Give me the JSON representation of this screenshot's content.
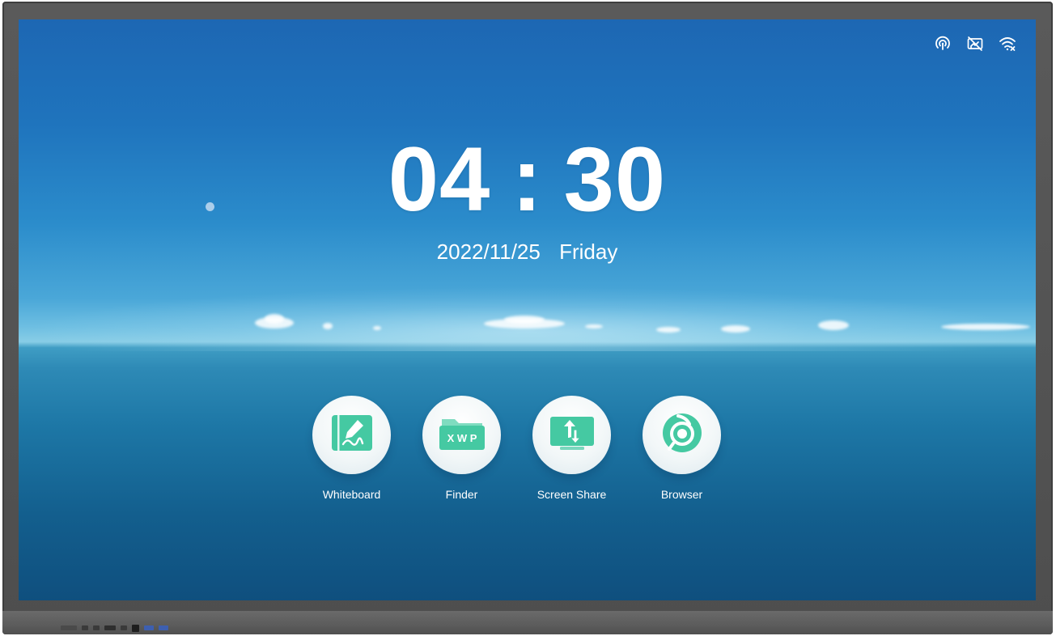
{
  "status_bar": {
    "icons": [
      "hotspot-icon",
      "screen-share-disabled-icon",
      "wifi-disconnected-icon"
    ]
  },
  "clock": {
    "hours": "04",
    "separator": ":",
    "minutes": "30"
  },
  "date": {
    "date": "2022/11/25",
    "weekday": "Friday"
  },
  "apps": [
    {
      "label": "Whiteboard",
      "icon": "whiteboard-icon"
    },
    {
      "label": "Finder",
      "icon": "folder-icon",
      "icon_text": "X W P"
    },
    {
      "label": "Screen Share",
      "icon": "screen-share-icon"
    },
    {
      "label": "Browser",
      "icon": "browser-icon"
    }
  ],
  "colors": {
    "app_icon_green": "#45c9a2",
    "text": "#ffffff"
  }
}
